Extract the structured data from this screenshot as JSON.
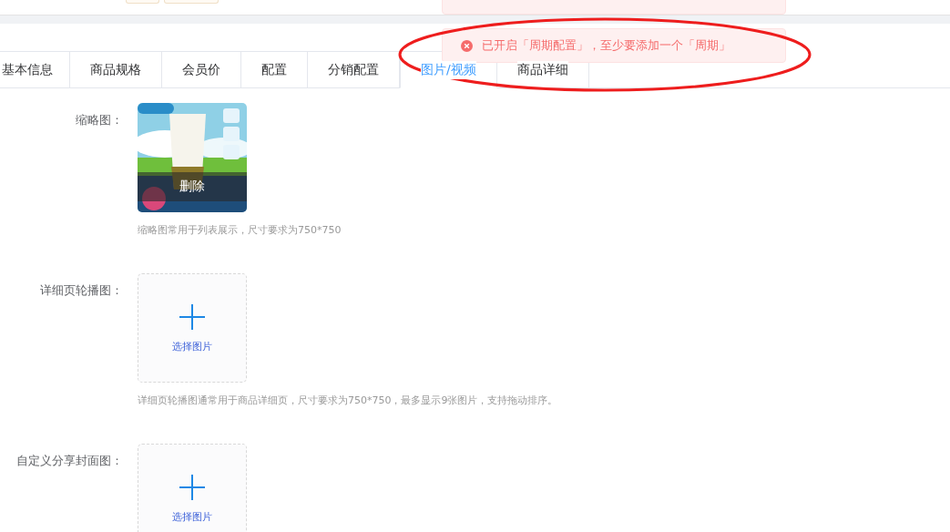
{
  "tabs": [
    {
      "label": "基本信息",
      "selected": false
    },
    {
      "label": "商品规格",
      "selected": false
    },
    {
      "label": "会员价",
      "selected": false
    },
    {
      "label": "配置",
      "selected": false
    },
    {
      "label": "分销配置",
      "selected": false
    },
    {
      "label": "图片/视频",
      "selected": true
    },
    {
      "label": "商品详细",
      "selected": false
    }
  ],
  "toast": {
    "message": "已开启「周期配置」，至少要添加一个「周期」"
  },
  "form": [
    {
      "label": "缩略图：",
      "delete_label": "删除",
      "hint": "缩略图常用于列表展示，尺寸要求为750*750"
    },
    {
      "kind": "upload",
      "label": "详细页轮播图：",
      "upload_label": "选择图片",
      "hint": "详细页轮播图通常用于商品详细页，尺寸要求为750*750，最多显示9张图片，支持拖动排序。"
    },
    {
      "kind": "upload",
      "label": "自定义分享封面图：",
      "upload_label": "选择图片"
    }
  ]
}
